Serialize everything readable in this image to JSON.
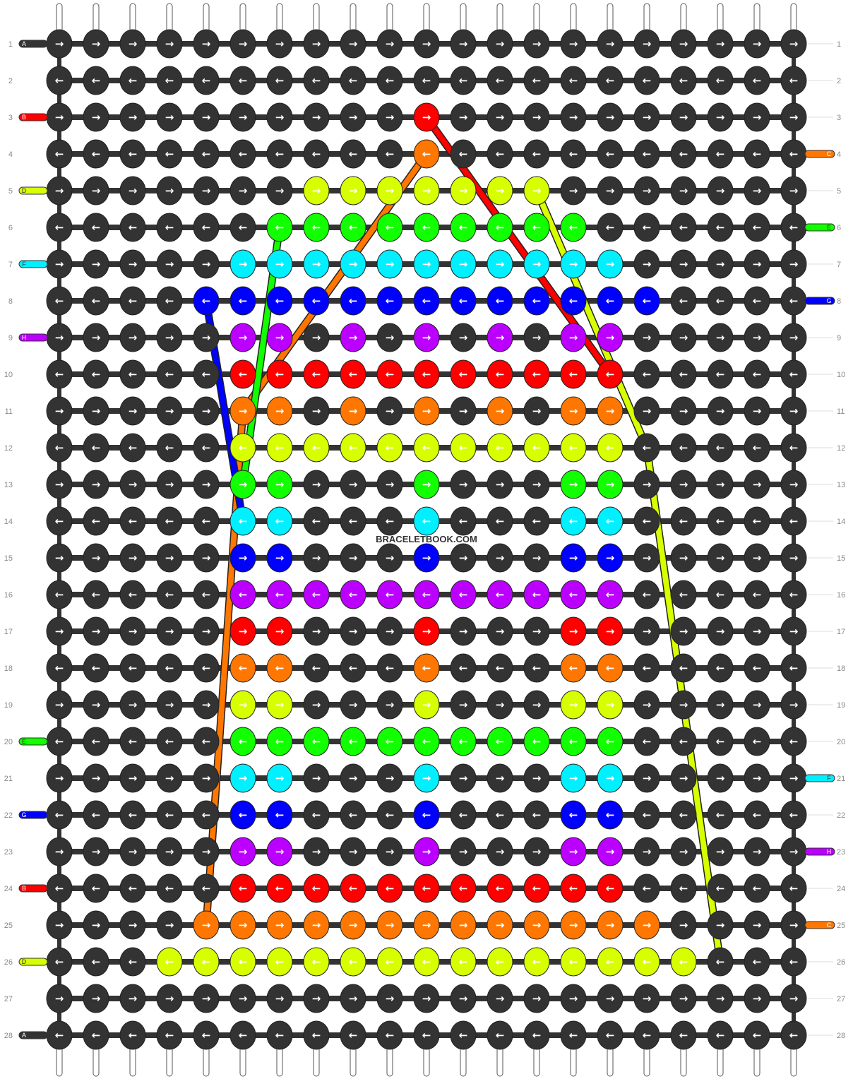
{
  "watermark": "BRACELETBOOK.COM",
  "grid": {
    "rows": 28,
    "strings": 21,
    "knots_per_row": 21
  },
  "colors": {
    "A": "#333333",
    "B": "#ff0000",
    "C": "#ff7700",
    "D": "#d8ff00",
    "E": "#11ff00",
    "F": "#00f0ff",
    "G": "#0000ff",
    "H": "#bb00ff"
  },
  "left_labels": [
    {
      "row": 1,
      "label": "A"
    },
    {
      "row": 3,
      "label": "B"
    },
    {
      "row": 5,
      "label": "D"
    },
    {
      "row": 7,
      "label": "F"
    },
    {
      "row": 9,
      "label": "H"
    },
    {
      "row": 20,
      "label": "E"
    },
    {
      "row": 22,
      "label": "G"
    },
    {
      "row": 24,
      "label": "B"
    },
    {
      "row": 26,
      "label": "D"
    },
    {
      "row": 28,
      "label": "A"
    }
  ],
  "right_labels": [
    {
      "row": 4,
      "label": "C"
    },
    {
      "row": 6,
      "label": "E"
    },
    {
      "row": 8,
      "label": "G"
    },
    {
      "row": 21,
      "label": "F"
    },
    {
      "row": 23,
      "label": "H"
    },
    {
      "row": 25,
      "label": "C"
    }
  ],
  "knot_rows": [
    "AAAAAAAAAAAAAAAAAAAAA",
    "AAAAAAAAAAAAAAAAAAAAA",
    "AAAAAAAAAABAAAAAAAAAA",
    "AAAAAAAAAACAAAAAAAAAA",
    "AAAAAAADDDDDDDAAAAAAA",
    "AAAAAAEEEEEEEEEAAAAAA",
    "AAAAAFFFFFFFFFFFAAAAA",
    "AAAAGGGGGGGGGGGGGAAAA",
    "AAAAAHHAHAHAHAHHAAAAA",
    "AAAAABBBBBBBBBBBAAAAA",
    "AAAAACCACACACACCAAAAA",
    "AAAAADDDDDDDDDDDAAAAA",
    "AAAAAEEAAAEAAAEEAAAAA",
    "AAAAAFFAAAFAAAFFAAAAA",
    "AAAAAGGAAAGAAAGGAAAAA",
    "AAAAAHHHHHHHHHHHAAAAA",
    "AAAAABBAAABAAABBAAAAA",
    "AAAAACCAAACAAACCAAAAA",
    "AAAAADDAAADAAADDAAAAA",
    "AAAAAEEEEEEEEEEEAAAAA",
    "AAAAAFFAAAFAAAFFAAAAA",
    "AAAAAGGAAAGAAAGGAAAAA",
    "AAAAAHHAAAHAAAHHAAAAA",
    "AAAAABBBBBBBBBBBAAAAA",
    "AAAACCCCCCCCCCCCCAAAA",
    "AAADDDDDDDDDDDDDDDAAA",
    "AAAAAAAAAAAAAAAAAAAAA",
    "AAAAAAAAAAAAAAAAAAAAA"
  ],
  "diagonal_strands": [
    {
      "color": "B",
      "points": [
        [
          11,
          3
        ],
        [
          16,
          10
        ]
      ]
    },
    {
      "color": "D",
      "points": [
        [
          14,
          5
        ],
        [
          17,
          12
        ],
        [
          19,
          26
        ]
      ]
    },
    {
      "color": "C",
      "points": [
        [
          11,
          4
        ],
        [
          6,
          11
        ],
        [
          5,
          25
        ]
      ]
    },
    {
      "color": "E",
      "points": [
        [
          7,
          6
        ],
        [
          6,
          13
        ]
      ]
    },
    {
      "color": "G",
      "points": [
        [
          5,
          8
        ],
        [
          6,
          14
        ]
      ]
    }
  ]
}
